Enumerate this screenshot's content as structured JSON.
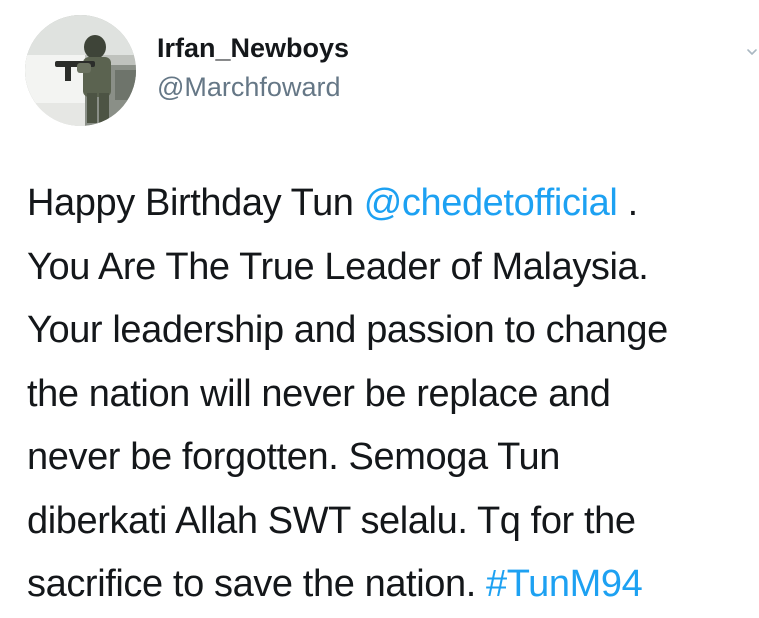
{
  "tweet": {
    "author": {
      "display_name": "Irfan_Newboys",
      "handle": "@Marchfoward",
      "avatar_icon": "avatar-photo-soldier"
    },
    "menu_icon": "chevron-down-icon",
    "text_lines": [
      {
        "before": "Happy Birthday Tun ",
        "mention": "@chedetofficial",
        "after": " ."
      },
      {
        "text": "You Are The True Leader of Malaysia."
      },
      {
        "text": "Your leadership and passion to change"
      },
      {
        "text": "the nation will never be replace and"
      },
      {
        "text": "never be forgotten. Semoga Tun"
      },
      {
        "text": "diberkati Allah SWT selalu. Tq for the"
      },
      {
        "before": "sacrifice to save the nation. ",
        "hashtag": "#TunM94"
      }
    ],
    "colors": {
      "link": "#1da1f2",
      "text": "#14171a",
      "secondary": "#657786"
    }
  }
}
